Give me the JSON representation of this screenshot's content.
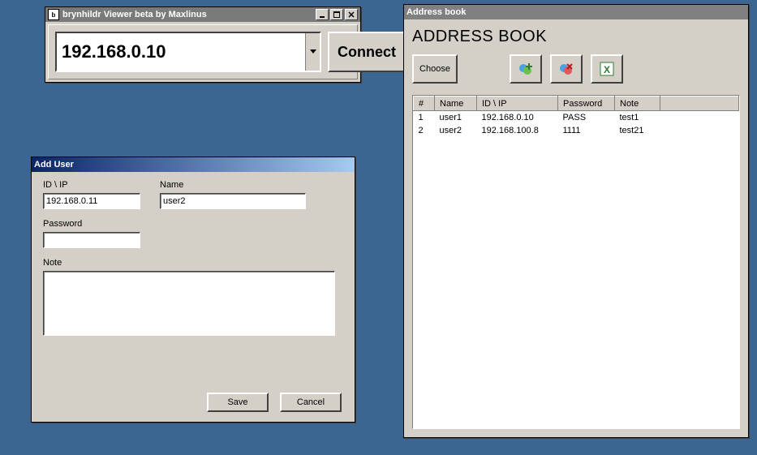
{
  "viewer": {
    "title": "brynhildr Viewer beta by Maxlinus",
    "address": "192.168.0.10",
    "connect_label": "Connect"
  },
  "adduser": {
    "title": "Add User",
    "labels": {
      "idip": "ID \\ IP",
      "name": "Name",
      "password": "Password",
      "note": "Note"
    },
    "values": {
      "idip": "192.168.0.11",
      "name": "user2",
      "password": "",
      "note": ""
    },
    "save_label": "Save",
    "cancel_label": "Cancel"
  },
  "abook": {
    "title": "Address book",
    "heading": "ADDRESS BOOK",
    "choose_label": "Choose",
    "columns": {
      "num": "#",
      "name": "Name",
      "idip": "ID \\ IP",
      "password": "Password",
      "note": "Note"
    },
    "rows": [
      {
        "num": "1",
        "name": "user1",
        "idip": "192.168.0.10",
        "password": "PASS",
        "note": "test1"
      },
      {
        "num": "2",
        "name": "user2",
        "idip": "192.168.100.8",
        "password": "1111",
        "note": "test21"
      }
    ]
  }
}
